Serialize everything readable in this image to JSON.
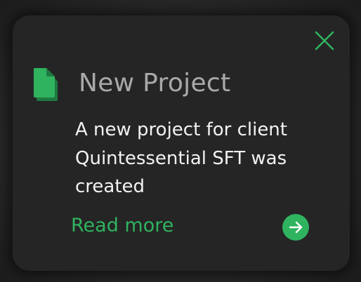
{
  "notification": {
    "title": "New Project",
    "message": "A new project for client Quintessential SFT was created",
    "link_label": "Read more"
  },
  "icons": {
    "close": "close-icon",
    "document": "document-icon",
    "arrow": "arrow-right-icon"
  },
  "colors": {
    "accent": "#2fb35f",
    "card_background": "#252525",
    "title_text": "#a9a9a9",
    "body_text": "#f2f2f2"
  }
}
